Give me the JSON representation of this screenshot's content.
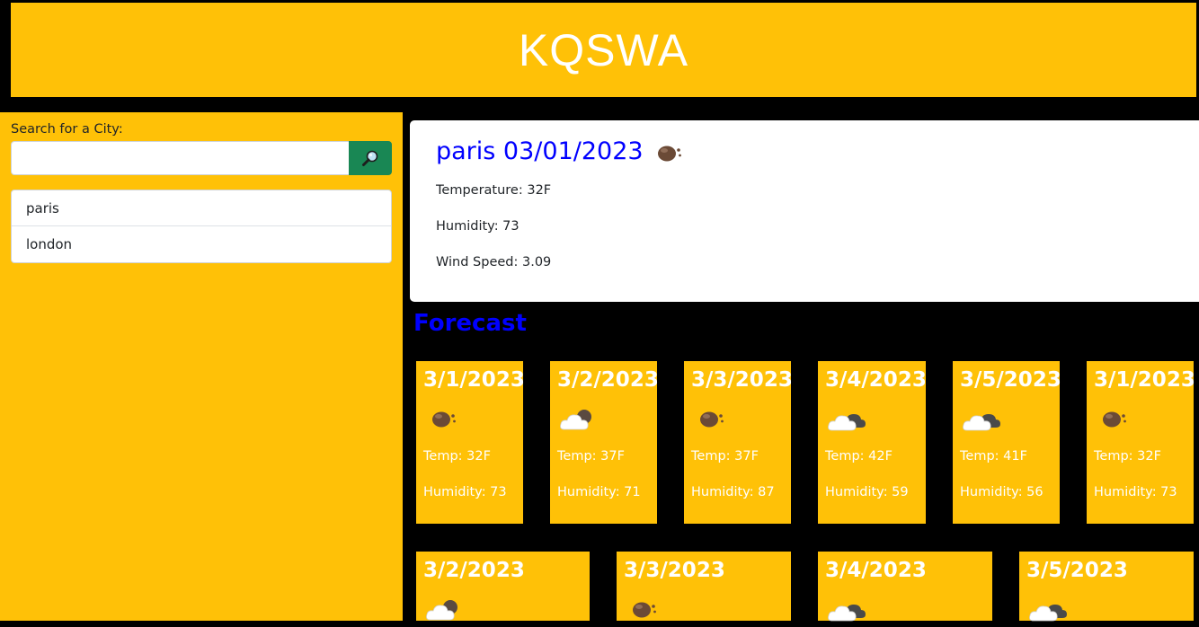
{
  "header": {
    "title": "KQSWA"
  },
  "sidebar": {
    "search_label": "Search for a City:",
    "search_placeholder": "",
    "search_value": "",
    "search_icon": "magnifier-icon",
    "history": [
      {
        "label": "paris"
      },
      {
        "label": "london"
      }
    ]
  },
  "current": {
    "title": "paris 03/01/2023",
    "icon": "rock-icon",
    "temperature": "Temperature: 32F",
    "humidity": "Humidity: 73",
    "wind": "Wind Speed: 3.09"
  },
  "forecast": {
    "heading": "Forecast",
    "cards": [
      {
        "date": "3/1/2023",
        "icon": "rock-icon",
        "temp": "Temp: 32F",
        "humidity": "Humidity: 73"
      },
      {
        "date": "3/2/2023",
        "icon": "cloud-icon",
        "temp": "Temp: 37F",
        "humidity": "Humidity: 71"
      },
      {
        "date": "3/3/2023",
        "icon": "rock-icon",
        "temp": "Temp: 37F",
        "humidity": "Humidity: 87"
      },
      {
        "date": "3/4/2023",
        "icon": "cloud-icon",
        "temp": "Temp: 42F",
        "humidity": "Humidity: 59"
      },
      {
        "date": "3/5/2023",
        "icon": "cloud-icon",
        "temp": "Temp: 41F",
        "humidity": "Humidity: 56"
      },
      {
        "date": "3/1/2023",
        "icon": "rock-icon",
        "temp": "Temp: 32F",
        "humidity": "Humidity: 73"
      }
    ],
    "second_row": [
      {
        "date": "3/2/2023",
        "icon": "cloud-icon"
      },
      {
        "date": "3/3/2023",
        "icon": "rock-icon"
      },
      {
        "date": "3/4/2023",
        "icon": "cloud-icon"
      },
      {
        "date": "3/5/2023",
        "icon": "cloud-icon"
      }
    ]
  },
  "colors": {
    "accent": "#ffc107",
    "title_blue": "#0000ff",
    "search_button": "#198754",
    "background": "#000000"
  }
}
